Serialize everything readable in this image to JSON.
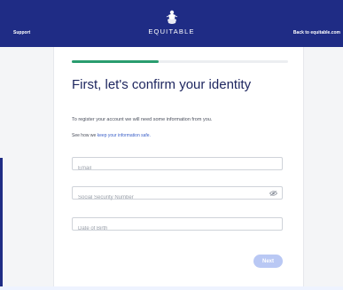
{
  "header": {
    "left_link": "Support",
    "right_link": "Back to equitable.com",
    "logo_text": "EQUITABLE",
    "logo_icon": "equitable-statue-icon",
    "bg_color": "#1f2c85"
  },
  "progress": {
    "fraction": 0.4,
    "color": "#2a9d6f"
  },
  "form": {
    "title": "First, let's confirm your identity",
    "intro": "To register your account we will need some information from you.",
    "privacy_prefix": "See how we ",
    "privacy_link": "keep your information safe.",
    "email_placeholder": "Email",
    "ssn_placeholder": "Social Security Number",
    "ssn_icon": "eye-icon",
    "dob_placeholder": "Date of Birth",
    "next_label": "Next",
    "next_color": "#b9c8f4"
  }
}
